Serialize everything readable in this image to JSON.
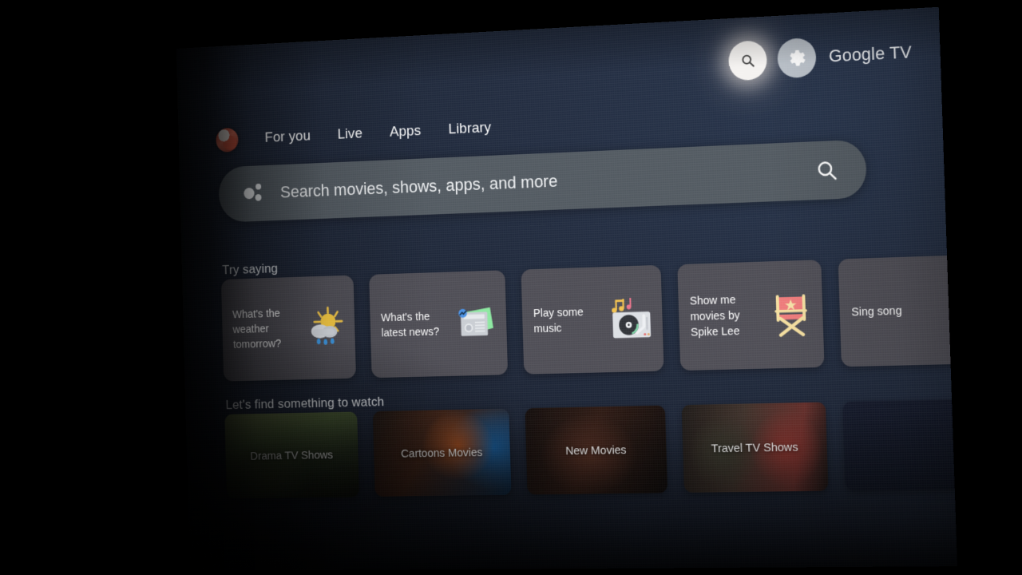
{
  "device": {
    "brand_label": "Google TV",
    "screen_bg": "#1e2636",
    "card_bg": "#4e4d55",
    "focus_glow": "#fff6ee"
  },
  "topbar": {
    "search_icon": "search-icon",
    "settings_icon": "gear-icon",
    "brand": "Google TV"
  },
  "nav": {
    "avatar": "profile-avatar",
    "items": [
      {
        "label": "For you"
      },
      {
        "label": "Live"
      },
      {
        "label": "Apps"
      },
      {
        "label": "Library"
      }
    ]
  },
  "search": {
    "assistant_icon": "google-assistant-icon",
    "placeholder": "Search movies, shows, apps, and more",
    "value": "",
    "magnifier_icon": "search-icon"
  },
  "try_saying": {
    "title": "Try saying",
    "cards": [
      {
        "text": "What's the weather tomorrow?",
        "emoji": "🌦️",
        "icon_name": "sun-behind-rain-cloud-icon"
      },
      {
        "text": "What's the latest news?",
        "emoji": "📰",
        "icon_name": "newspaper-icon"
      },
      {
        "text": "Play some music",
        "emoji": "🎶",
        "icon_name": "record-player-icon"
      },
      {
        "text": "Show me movies by Spike Lee",
        "emoji": "🎬",
        "icon_name": "director-chair-icon"
      },
      {
        "text": "Sing song",
        "emoji": "",
        "icon_name": "microphone-icon"
      }
    ]
  },
  "watch": {
    "title": "Let's find something to watch",
    "tiles": [
      {
        "label": "Drama TV Shows",
        "art": "art-drama"
      },
      {
        "label": "Cartoons Movies",
        "art": "art-cartoon"
      },
      {
        "label": "New Movies",
        "art": "art-newmovies"
      },
      {
        "label": "Travel TV Shows",
        "art": "art-travel"
      },
      {
        "label": "",
        "art": "art-partial"
      }
    ]
  }
}
